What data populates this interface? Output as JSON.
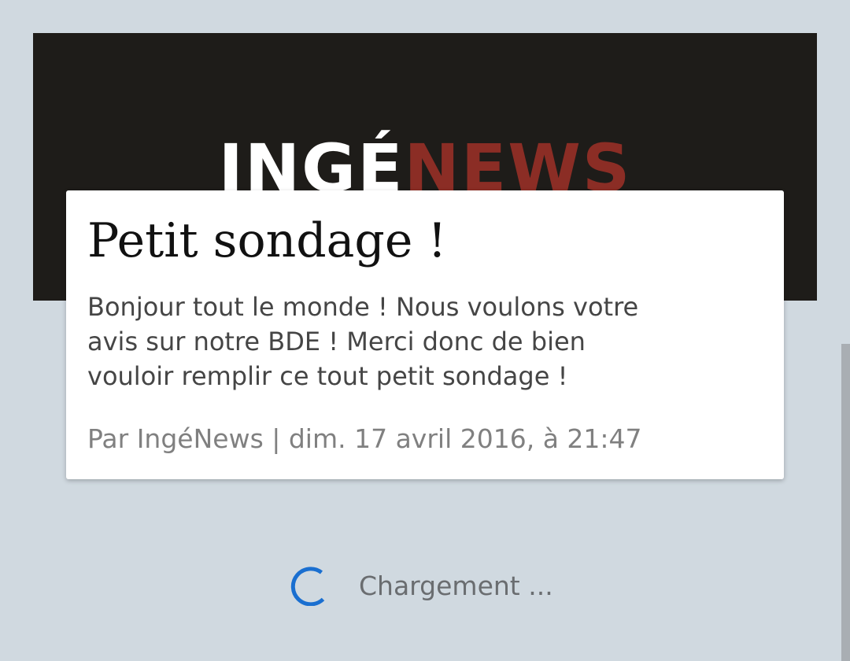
{
  "banner": {
    "logo_part1": "INGÉ",
    "logo_part2": "NEWS",
    "background": "#1e1c19",
    "accent": "#8b2d25"
  },
  "post": {
    "title": "Petit sondage !",
    "body_lines": [
      "Bonjour tout le monde ! Nous voulons votre",
      "avis sur notre BDE ! Merci donc de bien",
      "vouloir remplir ce tout petit sondage !"
    ],
    "meta": "Par IngéNews | dim. 17 avril 2016, à 21:47"
  },
  "loading": {
    "label": "Chargement ...",
    "icon": "spinner-icon",
    "color": "#1a6fd0"
  }
}
